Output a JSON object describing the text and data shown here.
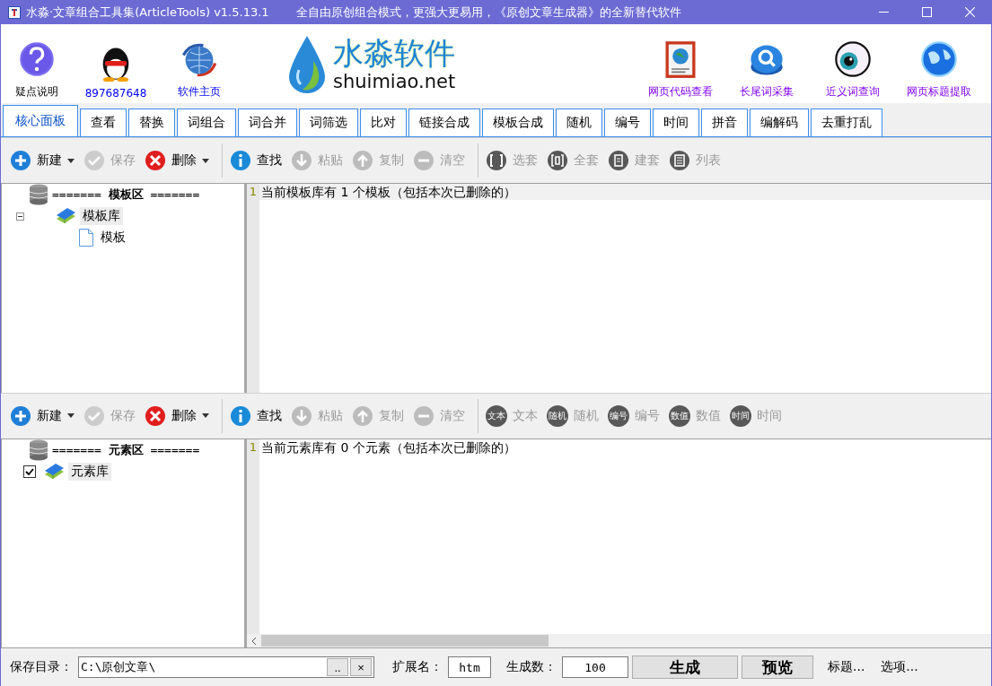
{
  "window": {
    "title": "水淼·文章组合工具集(ArticleTools) v1.5.13.1",
    "subtitle": "全自由原创组合模式，更强大更易用，《原创文章生成器》的全新替代软件"
  },
  "launchers": [
    {
      "label": "疑点说明"
    },
    {
      "label": "897687648"
    },
    {
      "label": "软件主页"
    },
    {
      "label": "网页代码查看"
    },
    {
      "label": "长尾词采集"
    },
    {
      "label": "近义词查询"
    },
    {
      "label": "网页标题提取"
    }
  ],
  "logo": {
    "name": "水淼软件",
    "site": "shuimiao.net"
  },
  "tabs": [
    {
      "label": "核心面板",
      "selected": true
    },
    {
      "label": "查看",
      "selected": false
    },
    {
      "label": "替换",
      "selected": false
    },
    {
      "label": "词组合",
      "selected": false
    },
    {
      "label": "词合并",
      "selected": false
    },
    {
      "label": "词筛选",
      "selected": false
    },
    {
      "label": "比对",
      "selected": false
    },
    {
      "label": "链接合成",
      "selected": false
    },
    {
      "label": "模板合成",
      "selected": false
    },
    {
      "label": "随机",
      "selected": false
    },
    {
      "label": "编号",
      "selected": false
    },
    {
      "label": "时间",
      "selected": false
    },
    {
      "label": "拼音",
      "selected": false
    },
    {
      "label": "编解码",
      "selected": false
    },
    {
      "label": "去重打乱",
      "selected": false
    }
  ],
  "panels": [
    {
      "toolbar": [
        {
          "label": "新建",
          "disabled": false,
          "dropdown": true
        },
        {
          "label": "保存",
          "disabled": true,
          "dropdown": false
        },
        {
          "label": "删除",
          "disabled": false,
          "dropdown": true
        },
        {
          "label": "查找",
          "disabled": false,
          "dropdown": false
        },
        {
          "label": "粘贴",
          "disabled": true,
          "dropdown": false
        },
        {
          "label": "复制",
          "disabled": true,
          "dropdown": false
        },
        {
          "label": "清空",
          "disabled": true,
          "dropdown": false
        },
        {
          "label": "选套",
          "disabled": true,
          "dropdown": false
        },
        {
          "label": "全套",
          "disabled": true,
          "dropdown": false
        },
        {
          "label": "建套",
          "disabled": true,
          "dropdown": false
        },
        {
          "label": "列表",
          "disabled": true,
          "dropdown": false
        }
      ],
      "tree": {
        "header": "======= **模板区** =======",
        "nodes": [
          {
            "label": "模板库",
            "kind": "library",
            "expanded": true,
            "selected": true,
            "children": [
              {
                "label": "模板",
                "kind": "file",
                "selected": false
              }
            ]
          }
        ]
      },
      "editor": {
        "lines": [
          {
            "number": "1",
            "text": "当前模板库有 1 个模板（包括本次已删除的）"
          }
        ]
      }
    },
    {
      "toolbar": [
        {
          "label": "新建",
          "disabled": false,
          "dropdown": true
        },
        {
          "label": "保存",
          "disabled": true,
          "dropdown": false
        },
        {
          "label": "删除",
          "disabled": false,
          "dropdown": true
        },
        {
          "label": "查找",
          "disabled": false,
          "dropdown": false
        },
        {
          "label": "粘贴",
          "disabled": true,
          "dropdown": false
        },
        {
          "label": "复制",
          "disabled": true,
          "dropdown": false
        },
        {
          "label": "清空",
          "disabled": true,
          "dropdown": false
        },
        {
          "label": "文本",
          "icon_text": "文本",
          "disabled": true,
          "dropdown": false
        },
        {
          "label": "随机",
          "icon_text": "随机",
          "disabled": true,
          "dropdown": false
        },
        {
          "label": "编号",
          "icon_text": "编号",
          "disabled": true,
          "dropdown": false
        },
        {
          "label": "数值",
          "icon_text": "数值",
          "disabled": true,
          "dropdown": false
        },
        {
          "label": "时间",
          "icon_text": "时间",
          "disabled": true,
          "dropdown": false
        }
      ],
      "tree": {
        "header": "======= **元素区** =======",
        "nodes": [
          {
            "label": "元素库",
            "kind": "library",
            "checked": true,
            "selected": true
          }
        ]
      },
      "editor": {
        "lines": [
          {
            "number": "1",
            "text": "当前元素库有 0 个元素（包括本次已删除的）"
          }
        ]
      }
    }
  ],
  "footer": {
    "dir_label": "保存目录：",
    "dir_value": "C:\\原创文章\\",
    "browse": "..",
    "clear": "×",
    "ext_label": "扩展名：",
    "ext_value": "htm",
    "count_label": "生成数：",
    "count_value": "100",
    "generate": "生成",
    "preview": "预览",
    "title_button": "标题...",
    "options_button": "选项..."
  }
}
